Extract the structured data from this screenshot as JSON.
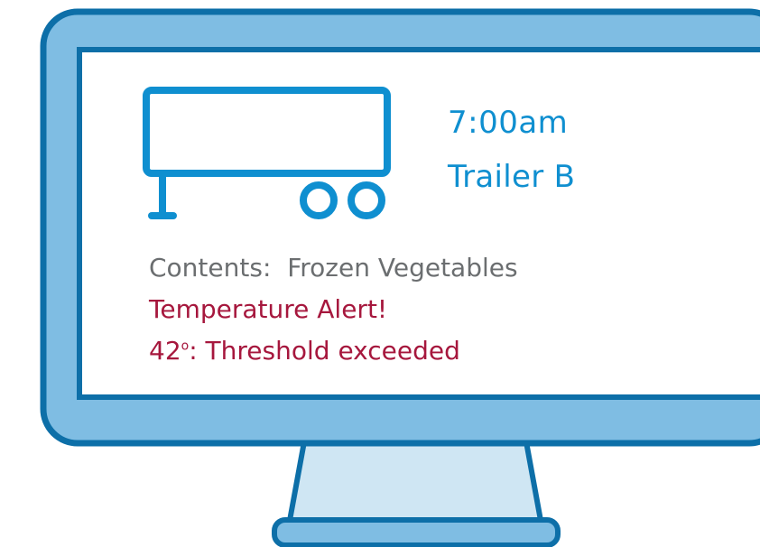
{
  "time": "7:00am",
  "trailer_name": "Trailer B",
  "contents_label": "Contents:",
  "contents_value": "Frozen Vegetables",
  "alert_text": "Temperature Alert!",
  "threshold": {
    "temperature": "42",
    "degree_symbol": "o",
    "message": ": Threshold exceeded"
  },
  "colors": {
    "frame_outline": "#0d6fa8",
    "frame_fill": "#7fbde3",
    "stand_fill": "#cfe6f3",
    "screen_fill": "#ffffff",
    "trailer_icon": "#0f8fd0",
    "info_text": "#0f8fd0",
    "contents_text": "#6b6e70",
    "alert_text": "#a6173d"
  },
  "icons": {
    "trailer": "trailer-icon"
  }
}
